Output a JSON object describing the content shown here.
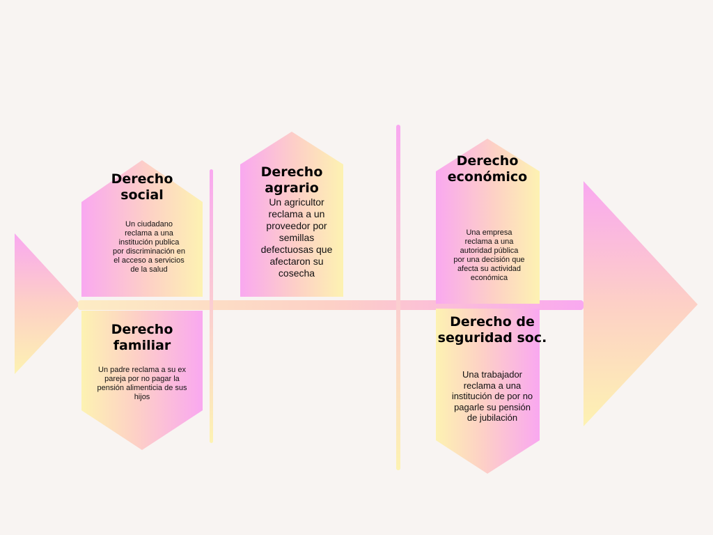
{
  "colors": {
    "pink": "#f9a8f0",
    "peach": "#fdd0c6",
    "yellow": "#fdf2b2",
    "spine": "#fccbd3",
    "background": "#f8f4f2"
  },
  "blocks": {
    "social": {
      "title": "Derecho\nsocial",
      "text": "Un ciudadano\nreclama a una\ninstitución  publica\npor discriminación en\nel acceso a servicios\nde la salud"
    },
    "agrario": {
      "title": "Derecho\nagrario",
      "text": "Un agricultor\nreclama a un\nproveedor por\nsemillas\ndefectuosas que\nafectaron su\ncosecha"
    },
    "economico": {
      "title": "Derecho\neconómico",
      "text": "Una empresa\nreclama a una\nautoridad pública\npor una decisión que\nafecta su actividad\neconómica"
    },
    "familiar": {
      "title": "Derecho\nfamiliar",
      "text": "Un padre reclama a su ex\npareja por no pagar la\npensión alimenticia de sus\nhijos"
    },
    "seguridad": {
      "title": "Derecho de\nseguridad soc.",
      "text": "Una trabajador\nreclama a una\ninstitución de por no\npagarle su pensión\nde jubilación"
    }
  }
}
